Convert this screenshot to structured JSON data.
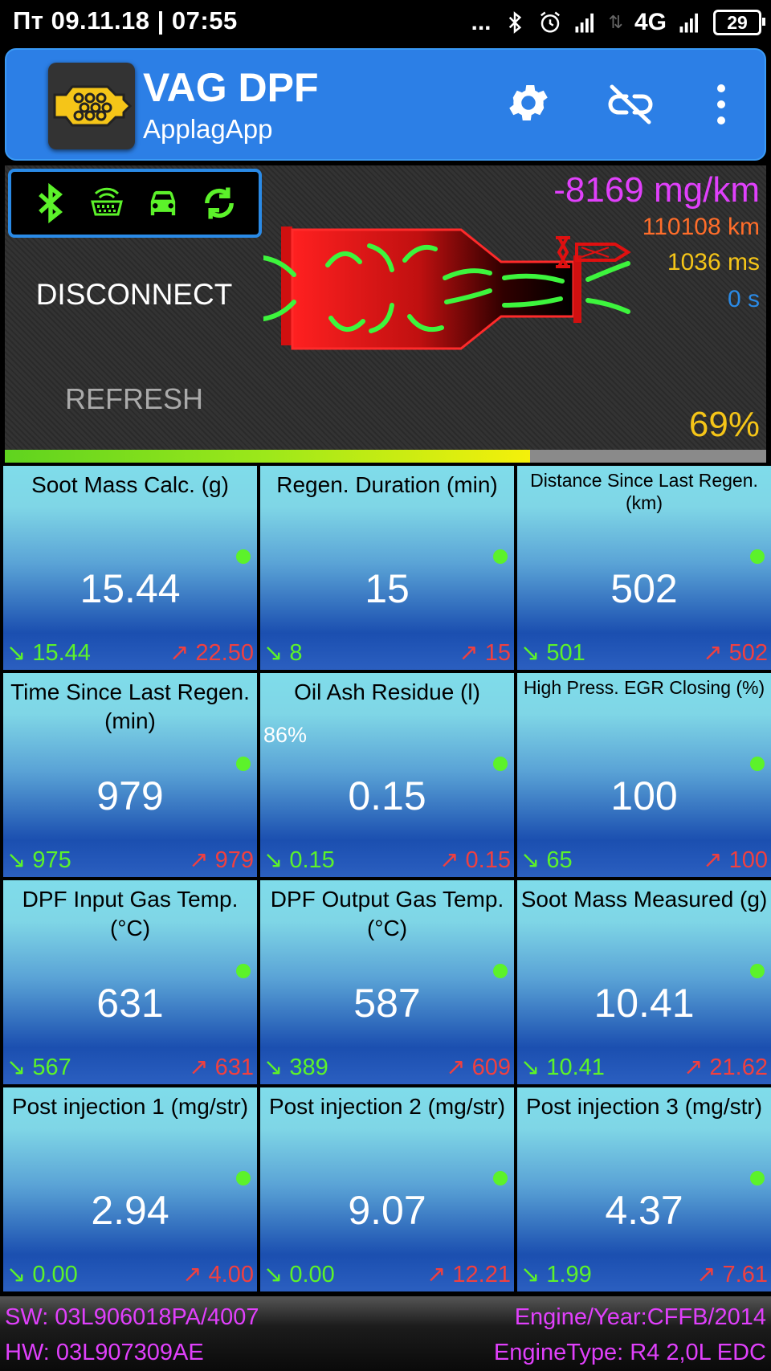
{
  "statusbar": {
    "datetime": "Пт 09.11.18 | 07:55",
    "dots": "...",
    "network": "4G",
    "battery": "29"
  },
  "app": {
    "title": "VAG DPF",
    "subtitle": "ApplagApp"
  },
  "hero": {
    "disconnect_label": "DISCONNECT",
    "refresh_label": "REFRESH",
    "rate": "-8169 mg/km",
    "distance": "110108 km",
    "response": "1036 ms",
    "time": "0 s",
    "percent": "69%"
  },
  "progress": {
    "fraction": 0.69
  },
  "tiles": [
    {
      "title": "Soot Mass Calc. (g)",
      "value": "15.44",
      "min": "↘ 15.44",
      "max": "↗ 22.50"
    },
    {
      "title": "Regen. Duration (min)",
      "value": "15",
      "min": "↘ 8",
      "max": "↗ 15"
    },
    {
      "title": "Distance Since Last Regen. (km)",
      "value": "502",
      "min": "↘ 501",
      "max": "↗ 502"
    },
    {
      "title": "Time Since Last Regen. (min)",
      "value": "979",
      "min": "↘ 975",
      "max": "↗ 979"
    },
    {
      "title": "Oil Ash Residue (l)",
      "value": "0.15",
      "min": "↘ 0.15",
      "max": "↗ 0.15",
      "extra": "86%"
    },
    {
      "title": "High Press. EGR Closing (%)",
      "value": "100",
      "min": "↘ 65",
      "max": "↗ 100"
    },
    {
      "title": "DPF Input Gas Temp. (°C)",
      "value": "631",
      "min": "↘ 567",
      "max": "↗ 631"
    },
    {
      "title": "DPF Output Gas Temp. (°C)",
      "value": "587",
      "min": "↘ 389",
      "max": "↗ 609"
    },
    {
      "title": "Soot Mass Measured (g)",
      "value": "10.41",
      "min": "↘ 10.41",
      "max": "↗ 21.62"
    },
    {
      "title": "Post injection 1 (mg/str)",
      "value": "2.94",
      "min": "↘ 0.00",
      "max": "↗ 4.00"
    },
    {
      "title": "Post injection 2 (mg/str)",
      "value": "9.07",
      "min": "↘ 0.00",
      "max": "↗ 12.21"
    },
    {
      "title": "Post injection 3 (mg/str)",
      "value": "4.37",
      "min": "↘ 1.99",
      "max": "↗ 7.61"
    }
  ],
  "footer": {
    "sw": "SW: 03L906018PA/4007",
    "hw": "HW: 03L907309AE",
    "engine_year": "Engine/Year:CFFB/2014",
    "engine_type": "EngineType: R4 2,0L EDC"
  },
  "colors": {
    "appbar": "#2c7fe6",
    "status_green": "#5cf22a",
    "rate": "#e040fb",
    "distance": "#ff6d2a",
    "response": "#f5c518",
    "time": "#2a8ae6",
    "max": "#f04040"
  }
}
